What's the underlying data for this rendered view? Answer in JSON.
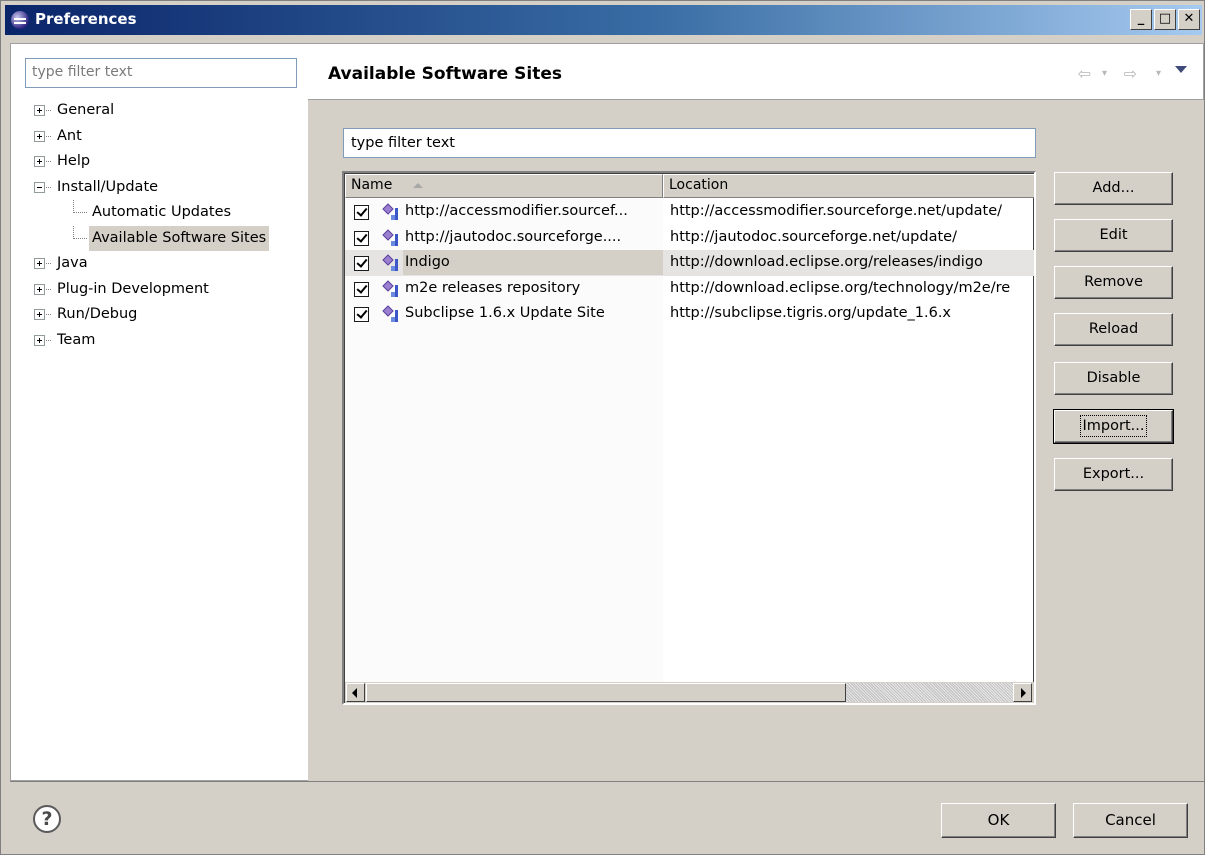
{
  "window": {
    "title": "Preferences",
    "controls": {
      "minimize": "_",
      "maximize": "□",
      "close": "✕"
    }
  },
  "sidebar": {
    "filter_placeholder": "type filter text",
    "tree": [
      {
        "label": "General",
        "expander": "plus"
      },
      {
        "label": "Ant",
        "expander": "plus"
      },
      {
        "label": "Help",
        "expander": "plus"
      },
      {
        "label": "Install/Update",
        "expander": "minus"
      },
      {
        "label": "Automatic Updates",
        "child": true
      },
      {
        "label": "Available Software Sites",
        "child": true,
        "selected": true
      },
      {
        "label": "Java",
        "expander": "plus"
      },
      {
        "label": "Plug-in Development",
        "expander": "plus"
      },
      {
        "label": "Run/Debug",
        "expander": "plus"
      },
      {
        "label": "Team",
        "expander": "plus"
      }
    ]
  },
  "page": {
    "title": "Available Software Sites",
    "nav_icons": [
      "back-arrow-icon",
      "dropdown-icon",
      "forward-arrow-icon",
      "dropdown-icon",
      "view-menu-icon"
    ],
    "filter_value": "type filter text",
    "columns": {
      "name": "Name",
      "location": "Location"
    },
    "sites": [
      {
        "name": "http://accessmodifier.sourcef...",
        "location": "http://accessmodifier.sourceforge.net/update/",
        "enabled": true
      },
      {
        "name": "http://jautodoc.sourceforge....",
        "location": "http://jautodoc.sourceforge.net/update/",
        "enabled": true
      },
      {
        "name": "Indigo",
        "location": "http://download.eclipse.org/releases/indigo",
        "enabled": true,
        "highlighted": true
      },
      {
        "name": "m2e releases repository",
        "location": "http://download.eclipse.org/technology/m2e/re",
        "enabled": true
      },
      {
        "name": "Subclipse 1.6.x Update Site",
        "location": "http://subclipse.tigris.org/update_1.6.x",
        "enabled": true
      }
    ],
    "buttons": {
      "add": "Add...",
      "edit": "Edit",
      "remove": "Remove",
      "reload": "Reload",
      "disable": "Disable",
      "import": "Import...",
      "export": "Export..."
    }
  },
  "footer": {
    "help": "?",
    "ok": "OK",
    "cancel": "Cancel"
  },
  "colors": {
    "titlebar": "#0a246a",
    "face": "#d4d0c8",
    "site_icon": "#9b7fd1"
  }
}
